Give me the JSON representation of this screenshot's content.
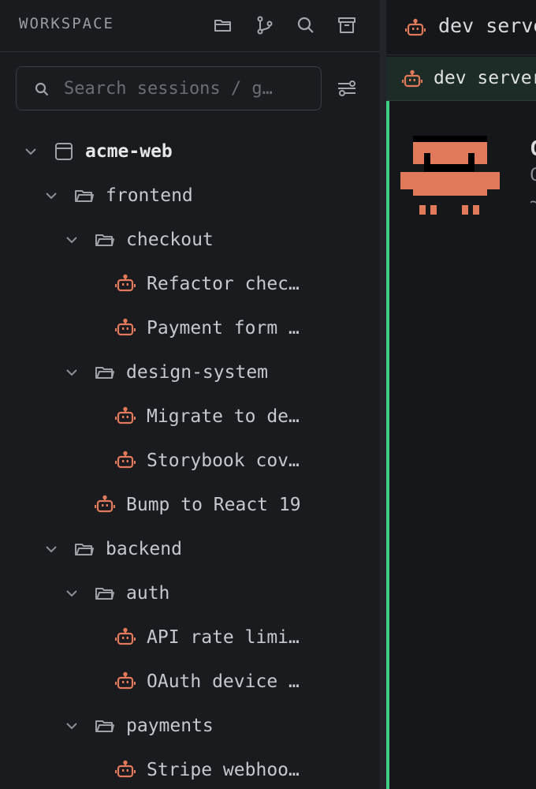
{
  "sidebar": {
    "title": "WORKSPACE",
    "header_icons": [
      "open-folder-icon",
      "git-branch-icon",
      "search-icon",
      "archive-icon"
    ],
    "search": {
      "placeholder": "Search sessions / g…",
      "value": ""
    },
    "filter_icon": "filter-icon"
  },
  "tree": [
    {
      "label": "acme-web",
      "kind": "project",
      "depth": 0,
      "expanded": true
    },
    {
      "label": "frontend",
      "kind": "folder",
      "depth": 1,
      "expanded": true
    },
    {
      "label": "checkout",
      "kind": "folder",
      "depth": 2,
      "expanded": true
    },
    {
      "label": "Refactor chec…",
      "kind": "session",
      "depth": 3
    },
    {
      "label": "Payment form …",
      "kind": "session",
      "depth": 3
    },
    {
      "label": "design-system",
      "kind": "folder",
      "depth": 2,
      "expanded": true
    },
    {
      "label": "Migrate to de…",
      "kind": "session",
      "depth": 3
    },
    {
      "label": "Storybook cov…",
      "kind": "session",
      "depth": 3
    },
    {
      "label": "Bump to React 19",
      "kind": "session",
      "depth": 2
    },
    {
      "label": "backend",
      "kind": "folder",
      "depth": 1,
      "expanded": true
    },
    {
      "label": "auth",
      "kind": "folder",
      "depth": 2,
      "expanded": true
    },
    {
      "label": "API rate limi…",
      "kind": "session",
      "depth": 3
    },
    {
      "label": "OAuth device …",
      "kind": "session",
      "depth": 3
    },
    {
      "label": "payments",
      "kind": "folder",
      "depth": 2,
      "expanded": true
    },
    {
      "label": "Stripe webhoo…",
      "kind": "session",
      "depth": 3
    }
  ],
  "pane": {
    "tab_label": "dev serve",
    "session_bar_label": "dev server",
    "extra_text": [
      "C",
      "C",
      "~"
    ]
  },
  "colors": {
    "accent": "#3fce85",
    "robot": "#e07a5a",
    "background": "#16171b",
    "sidebar": "#1a1b1f"
  }
}
